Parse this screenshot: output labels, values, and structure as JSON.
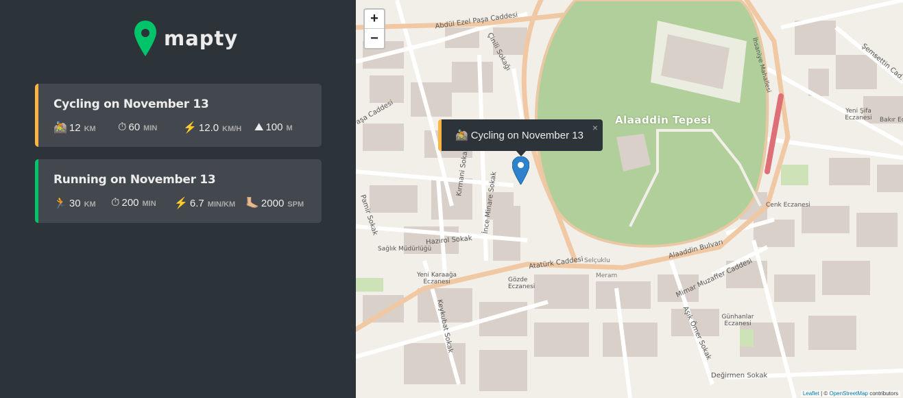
{
  "app": {
    "name": "mapty"
  },
  "workouts": [
    {
      "title": "Cycling on November 13",
      "type": "cycling",
      "accent": "#ffb545",
      "details": [
        {
          "icon": "🚵",
          "icon_name": "cycling-icon",
          "value": "12",
          "unit": "km"
        },
        {
          "icon": "⏱",
          "icon_name": "stopwatch-icon",
          "value": "60",
          "unit": "min"
        },
        {
          "icon": "⚡️",
          "icon_name": "lightning-icon",
          "value": "12.0",
          "unit": "km/h"
        },
        {
          "icon": "⛰",
          "icon_name": "mountain-icon",
          "value": "100",
          "unit": "m"
        }
      ]
    },
    {
      "title": "Running on November 13",
      "type": "running",
      "accent": "#00c46a",
      "details": [
        {
          "icon": "🏃",
          "icon_name": "running-icon",
          "value": "30",
          "unit": "km"
        },
        {
          "icon": "⏱",
          "icon_name": "stopwatch-icon",
          "value": "200",
          "unit": "min"
        },
        {
          "icon": "⚡️",
          "icon_name": "lightning-icon",
          "value": "6.7",
          "unit": "min/km"
        },
        {
          "icon": "🦶🏼",
          "icon_name": "foot-icon",
          "value": "2000",
          "unit": "spm"
        }
      ]
    }
  ],
  "map": {
    "zoom_in": "+",
    "zoom_out": "−",
    "popup": {
      "icon": "🚵",
      "text": "Cycling on November 13",
      "close": "×"
    },
    "attribution": {
      "leaflet": "Leaflet",
      "sep": " | © ",
      "osm": "OpenStreetMap",
      "suffix": " contributors"
    },
    "labels": {
      "park": "Alaaddin Tepesi",
      "l1": "Abdül Ezel Paşa Caddesi",
      "l2": "Çinili Sokağı",
      "l3": "Kırmani Sokak",
      "l4": "İnce Minare Sokak",
      "l5": "Hazırol Sokak",
      "l6": "Atatürk Caddesi",
      "l7": "Alaaddin Bulvarı",
      "l8": "Mimar Muzaffer Caddesi",
      "l9": "Aşık Ömer Sokak",
      "l10": "Keykubat Sokak",
      "l11": "Değirmen Sokak",
      "l12": "Sağlık Müdürlüğü",
      "l13": "Yeni Karaağa Eczanesi",
      "l14": "Gözde Eczanesi",
      "l15": "Günhanlar Eczanesi",
      "l16": "Cenk Eczanesi",
      "l17": "Yeni Şifa Eczanesi",
      "l18": "Meram",
      "l19": "Selçuklu",
      "l20": "Pamir Sokak",
      "l21": "Şemsettin Cad.",
      "l22": "İhsaniye Mahallesi",
      "l23": "Bakır Ec.",
      "l24": "Paşa Caddesi"
    }
  }
}
